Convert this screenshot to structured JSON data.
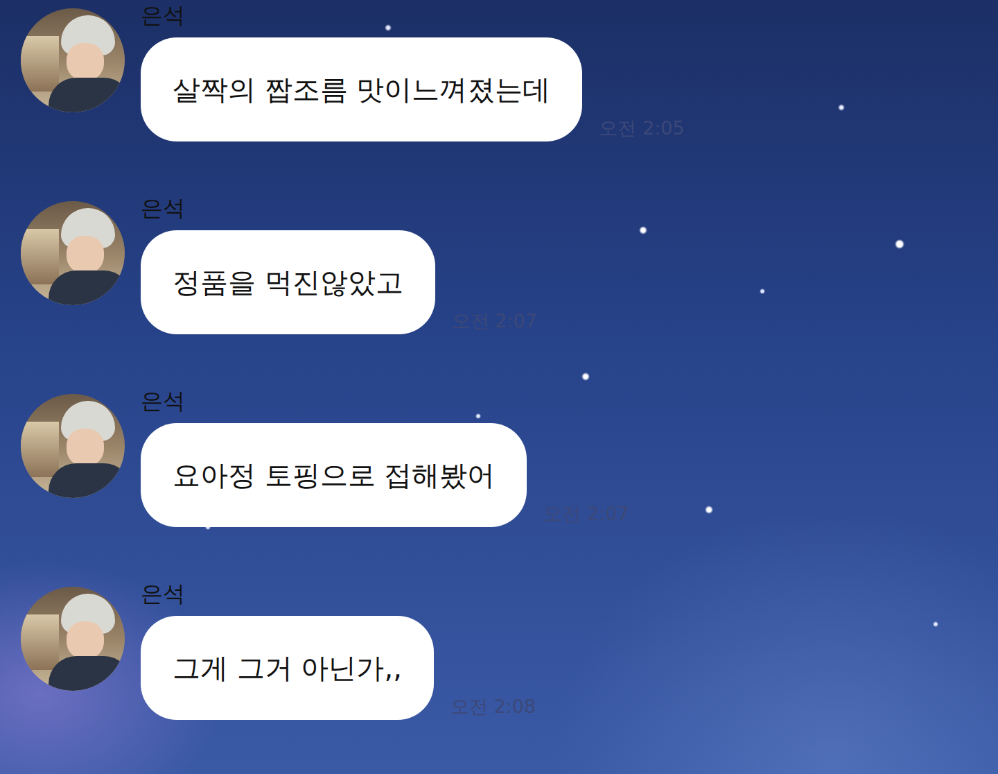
{
  "chat": {
    "messages": [
      {
        "sender": "은석",
        "text": "살짝의 짭조름 맛이느껴졌는데",
        "time": "오전 2:05"
      },
      {
        "sender": "은석",
        "text": "정품을 먹진않았고",
        "time": "오전 2:07"
      },
      {
        "sender": "은석",
        "text": "요아정 토핑으로 접해봤어",
        "time": "오전 2:07"
      },
      {
        "sender": "은석",
        "text": "그게 그거 아닌가,,",
        "time": "오전 2:08"
      }
    ]
  }
}
